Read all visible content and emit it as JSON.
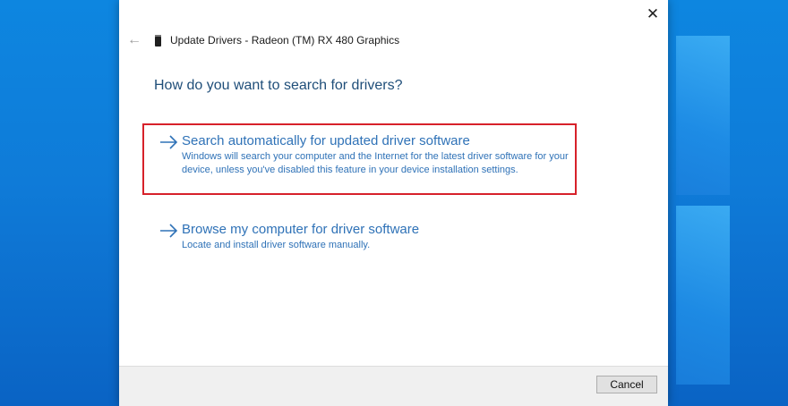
{
  "dialog": {
    "title": "Update Drivers - Radeon (TM) RX 480 Graphics",
    "question": "How do you want to search for drivers?",
    "options": [
      {
        "title": "Search automatically for updated driver software",
        "description": "Windows will search your computer and the Internet for the latest driver software for your device, unless you've disabled this feature in your device installation settings."
      },
      {
        "title": "Browse my computer for driver software",
        "description": "Locate and install driver software manually."
      }
    ],
    "cancel_label": "Cancel"
  },
  "icons": {
    "close": "close-icon",
    "back": "back-arrow-icon",
    "device": "device-icon",
    "option_arrow": "arrow-right-icon"
  },
  "colors": {
    "link": "#2f72b7",
    "heading": "#1f4e79",
    "highlight": "#d7212a",
    "desktop": "#0f7bd8"
  }
}
